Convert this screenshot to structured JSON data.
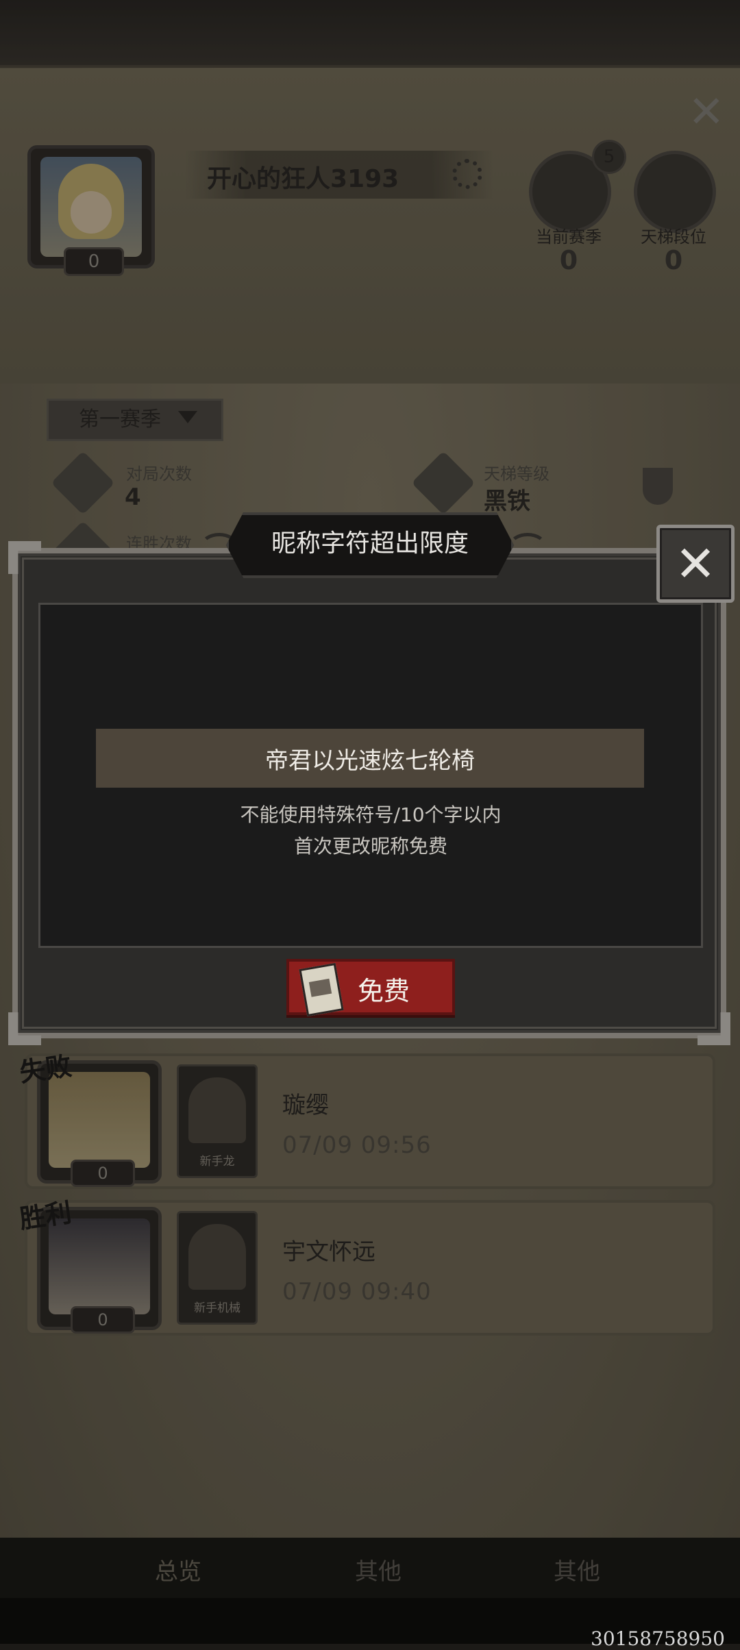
{
  "background": {
    "close_glyph": "✕",
    "player": {
      "name": "开心的狂人3193",
      "level": "0"
    },
    "badges": [
      {
        "label": "当前赛季",
        "value": "0",
        "rank": "5"
      },
      {
        "label": "天梯段位",
        "value": "0"
      }
    ],
    "season_selector": "第一赛季",
    "stats": [
      {
        "label": "对局次数",
        "value": "4"
      },
      {
        "label": "天梯等级",
        "value": "黑铁"
      },
      {
        "label": "连胜次数",
        "value": ""
      }
    ],
    "records": [
      {
        "result": "失败",
        "level": "0",
        "card_name": "新手龙",
        "opponent": "璇缨",
        "time": "07/09 09:56"
      },
      {
        "result": "胜利",
        "level": "0",
        "card_name": "新手机械",
        "opponent": "宇文怀远",
        "time": "07/09 09:40"
      }
    ],
    "nav": [
      "总览",
      "其他",
      "其他"
    ]
  },
  "dialog": {
    "title": "昵称字符超出限度",
    "close_glyph": "✕",
    "name_value": "帝君以光速炫七轮椅",
    "hint_line1": "不能使用特殊符号/10个字以内",
    "hint_line2": "首次更改昵称免费",
    "free_button": "免费"
  },
  "footer_id": "30158758950",
  "colors": {
    "accent_red": "#8e1f1d",
    "input_bg": "#4d453a",
    "dialog_bg": "#2c2b29"
  },
  "icons": [
    "close-icon",
    "gear-icon",
    "season-shield-icon",
    "ladder-hourglass-icon",
    "crossed-swords-icon",
    "crown-icon",
    "trophy-icon",
    "ticket-icon",
    "dropdown-arrow-icon"
  ]
}
